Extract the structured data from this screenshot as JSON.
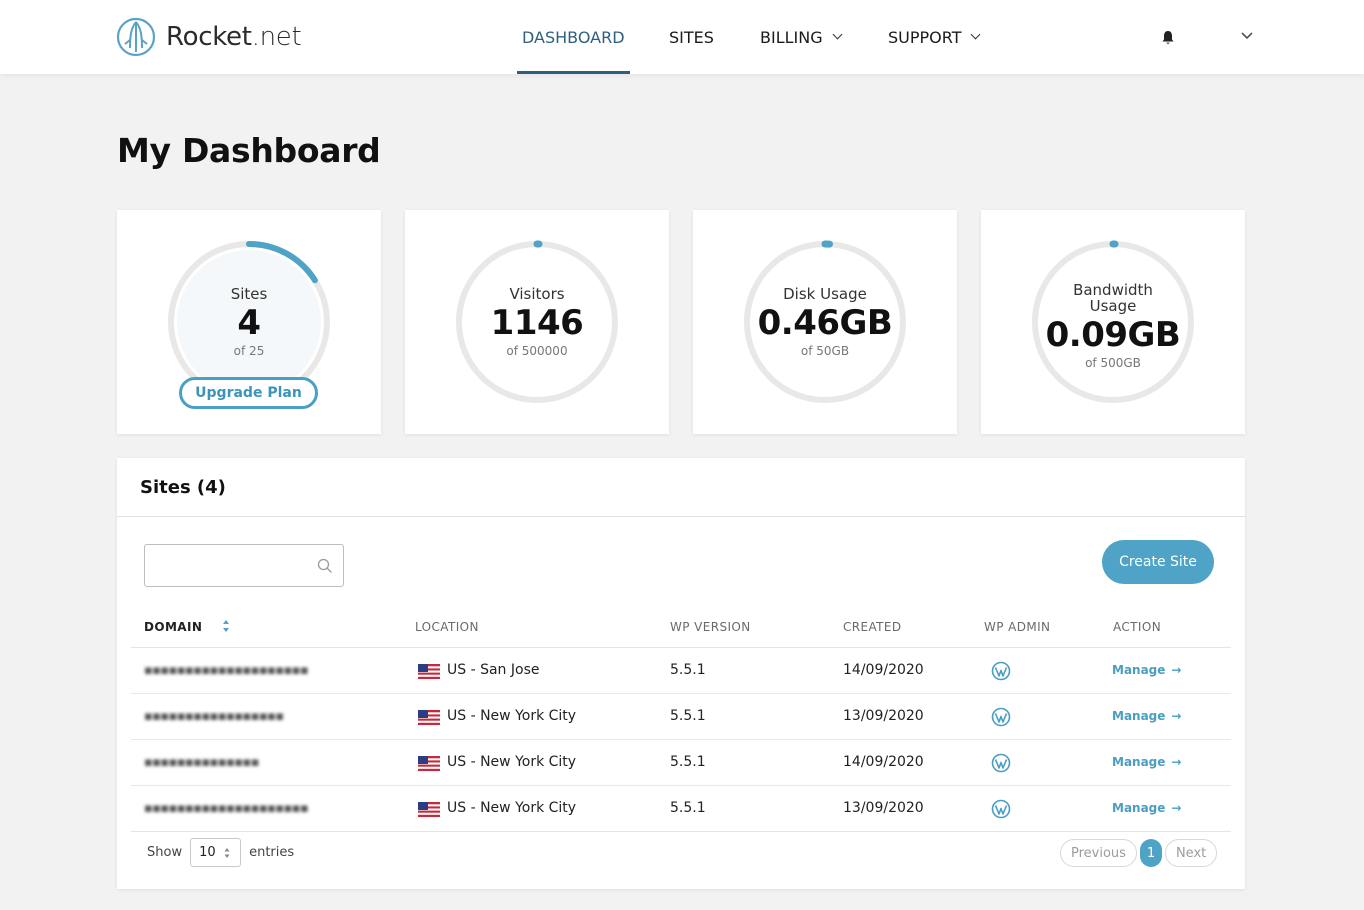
{
  "brand": {
    "name_main": "Rocket",
    "name_suffix": ".net",
    "logo_icon": "rocket-logo-icon",
    "accent": "#4ea3c6",
    "nav_active_color": "#2f5f7e"
  },
  "nav": {
    "items": [
      {
        "label": "DASHBOARD",
        "active": true
      },
      {
        "label": "SITES",
        "active": false
      },
      {
        "label": "BILLING",
        "active": false,
        "dropdown": true
      },
      {
        "label": "SUPPORT",
        "active": false,
        "dropdown": true
      }
    ],
    "bell_icon": "bell-icon",
    "account_icon": "chevron-down-icon"
  },
  "page": {
    "title": "My Dashboard"
  },
  "stats": [
    {
      "label": "Sites",
      "value": "4",
      "sub": "of 25",
      "fraction": 0.16
    },
    {
      "label": "Visitors",
      "value": "1146",
      "sub": "of 500000",
      "fraction": 0.0023
    },
    {
      "label": "Disk Usage",
      "value": "0.46GB",
      "sub": "of 50GB",
      "fraction": 0.0092
    },
    {
      "label": "Bandwidth Usage",
      "value": "0.09GB",
      "sub": "of 500GB",
      "fraction": 0.0002
    }
  ],
  "upgrade_label": "Upgrade Plan",
  "sites": {
    "title": "Sites (4)",
    "search_placeholder": "",
    "create_label": "Create Site",
    "columns": {
      "domain": "DOMAIN",
      "location": "LOCATION",
      "wp_version": "WP VERSION",
      "created": "CREATED",
      "wp_admin": "WP ADMIN",
      "action": "ACTION"
    },
    "rows": [
      {
        "domain": "▪▪▪▪▪▪▪▪▪▪▪▪▪▪▪▪▪▪▪▪",
        "location": "US - San Jose",
        "wp_version": "5.5.1",
        "created": "14/09/2020",
        "action": "Manage"
      },
      {
        "domain": "▪▪▪▪▪▪▪▪▪▪▪▪▪▪▪▪▪",
        "location": "US - New York City",
        "wp_version": "5.5.1",
        "created": "13/09/2020",
        "action": "Manage"
      },
      {
        "domain": "▪▪▪▪▪▪▪▪▪▪▪▪▪▪",
        "location": "US - New York City",
        "wp_version": "5.5.1",
        "created": "14/09/2020",
        "action": "Manage"
      },
      {
        "domain": "▪▪▪▪▪▪▪▪▪▪▪▪▪▪▪▪▪▪▪▪",
        "location": "US - New York City",
        "wp_version": "5.5.1",
        "created": "13/09/2020",
        "action": "Manage"
      }
    ],
    "show_label": "Show",
    "entries_value": "10",
    "entries_label": "entries",
    "pager": {
      "previous": "Previous",
      "current": "1",
      "next": "Next"
    }
  }
}
